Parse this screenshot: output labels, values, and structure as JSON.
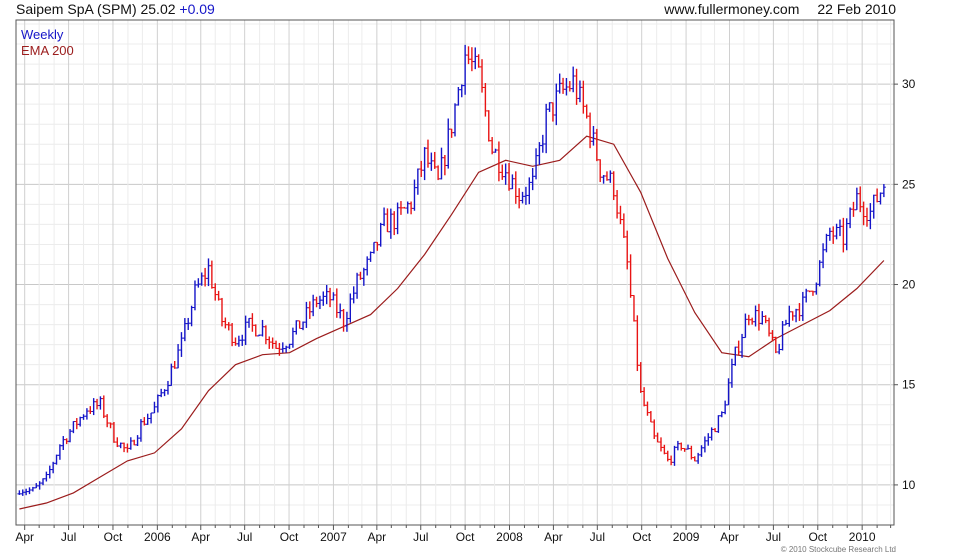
{
  "header": {
    "title": "Saipem SpA (SPM) 25.02",
    "change": "+0.09",
    "site": "www.fullermoney.com",
    "date": "22 Feb 2010"
  },
  "legend": {
    "line1": "Weekly",
    "line2": "EMA 200"
  },
  "credit": "© 2010 Stockcube Research Ltd",
  "colors": {
    "up": "#1515c8",
    "down": "#e81414",
    "ema": "#9b1c1c",
    "grid": "#d8d8d8"
  },
  "chart_data": {
    "type": "line",
    "grid": true,
    "y_axis_side": "right",
    "ylim": [
      8.0,
      33.2
    ],
    "yticks": [
      10,
      15,
      20,
      25,
      30
    ],
    "xlim": [
      "2005-03-14",
      "2010-03-08"
    ],
    "xticks": [
      {
        "date": "2005-04-01",
        "label": "Apr"
      },
      {
        "date": "2005-07-01",
        "label": "Jul"
      },
      {
        "date": "2005-10-01",
        "label": "Oct"
      },
      {
        "date": "2006-01-01",
        "label": "2006"
      },
      {
        "date": "2006-04-01",
        "label": "Apr"
      },
      {
        "date": "2006-07-01",
        "label": "Jul"
      },
      {
        "date": "2006-10-01",
        "label": "Oct"
      },
      {
        "date": "2007-01-01",
        "label": "2007"
      },
      {
        "date": "2007-04-01",
        "label": "Apr"
      },
      {
        "date": "2007-07-01",
        "label": "Jul"
      },
      {
        "date": "2007-10-01",
        "label": "Oct"
      },
      {
        "date": "2008-01-01",
        "label": "2008"
      },
      {
        "date": "2008-04-01",
        "label": "Apr"
      },
      {
        "date": "2008-07-01",
        "label": "Jul"
      },
      {
        "date": "2008-10-01",
        "label": "Oct"
      },
      {
        "date": "2009-01-01",
        "label": "2009"
      },
      {
        "date": "2009-04-01",
        "label": "Apr"
      },
      {
        "date": "2009-07-01",
        "label": "Jul"
      },
      {
        "date": "2009-10-01",
        "label": "Oct"
      },
      {
        "date": "2010-01-01",
        "label": "2010"
      }
    ],
    "series": [
      {
        "name": "Weekly",
        "style": "ohlc",
        "x": [
          "2005-03-21",
          "2005-04-18",
          "2005-05-16",
          "2005-06-13",
          "2005-07-11",
          "2005-08-08",
          "2005-09-05",
          "2005-10-03",
          "2005-10-31",
          "2005-11-28",
          "2005-12-26",
          "2006-01-23",
          "2006-02-20",
          "2006-03-20",
          "2006-04-17",
          "2006-05-15",
          "2006-06-12",
          "2006-07-10",
          "2006-08-07",
          "2006-09-04",
          "2006-10-02",
          "2006-10-30",
          "2006-11-27",
          "2006-12-25",
          "2007-01-22",
          "2007-02-19",
          "2007-03-19",
          "2007-04-16",
          "2007-05-14",
          "2007-06-11",
          "2007-07-09",
          "2007-08-06",
          "2007-09-03",
          "2007-10-01",
          "2007-10-29",
          "2007-11-26",
          "2007-12-24",
          "2008-01-21",
          "2008-02-18",
          "2008-03-17",
          "2008-04-14",
          "2008-05-12",
          "2008-06-09",
          "2008-07-07",
          "2008-08-04",
          "2008-09-01",
          "2008-09-29",
          "2008-10-27",
          "2008-11-24",
          "2008-12-22",
          "2009-01-19",
          "2009-02-16",
          "2009-03-16",
          "2009-04-13",
          "2009-05-11",
          "2009-06-08",
          "2009-07-06",
          "2009-08-03",
          "2009-08-31",
          "2009-09-28",
          "2009-10-26",
          "2009-11-23",
          "2009-12-21",
          "2010-01-18",
          "2010-02-15"
        ],
        "values": [
          9.8,
          9.7,
          10.3,
          12.0,
          12.9,
          13.8,
          14.0,
          12.4,
          11.6,
          13.0,
          13.8,
          15.3,
          17.0,
          19.6,
          20.8,
          18.2,
          17.3,
          17.9,
          17.8,
          16.9,
          17.3,
          18.2,
          19.2,
          19.3,
          18.2,
          20.1,
          21.2,
          23.0,
          23.3,
          24.1,
          26.4,
          25.0,
          28.0,
          31.5,
          30.4,
          26.8,
          25.7,
          24.5,
          25.0,
          28.3,
          29.5,
          30.1,
          28.3,
          25.8,
          24.9,
          21.0,
          14.5,
          12.3,
          11.2,
          12.0,
          11.3,
          12.4,
          13.5,
          16.5,
          18.6,
          18.3,
          16.5,
          18.6,
          19.0,
          20.4,
          22.6,
          22.3,
          24.3,
          23.6,
          25.02
        ]
      },
      {
        "name": "EMA 200",
        "style": "line",
        "x": [
          "2005-03-21",
          "2005-05-16",
          "2005-07-11",
          "2005-09-05",
          "2005-10-31",
          "2005-12-26",
          "2006-02-20",
          "2006-04-17",
          "2006-06-12",
          "2006-08-07",
          "2006-10-02",
          "2006-11-27",
          "2007-01-22",
          "2007-03-19",
          "2007-05-14",
          "2007-07-09",
          "2007-09-03",
          "2007-10-29",
          "2007-12-24",
          "2008-02-18",
          "2008-04-14",
          "2008-06-09",
          "2008-08-04",
          "2008-09-29",
          "2008-11-24",
          "2009-01-19",
          "2009-03-16",
          "2009-05-11",
          "2009-07-06",
          "2009-08-31",
          "2009-10-26",
          "2009-12-21",
          "2010-02-15"
        ],
        "values": [
          8.8,
          9.1,
          9.6,
          10.4,
          11.2,
          11.6,
          12.8,
          14.7,
          16.0,
          16.5,
          16.6,
          17.3,
          17.9,
          18.5,
          19.8,
          21.5,
          23.5,
          25.6,
          26.2,
          25.9,
          26.2,
          27.4,
          27.0,
          24.6,
          21.3,
          18.6,
          16.6,
          16.4,
          17.3,
          18.0,
          18.7,
          19.8,
          21.2
        ]
      }
    ]
  }
}
